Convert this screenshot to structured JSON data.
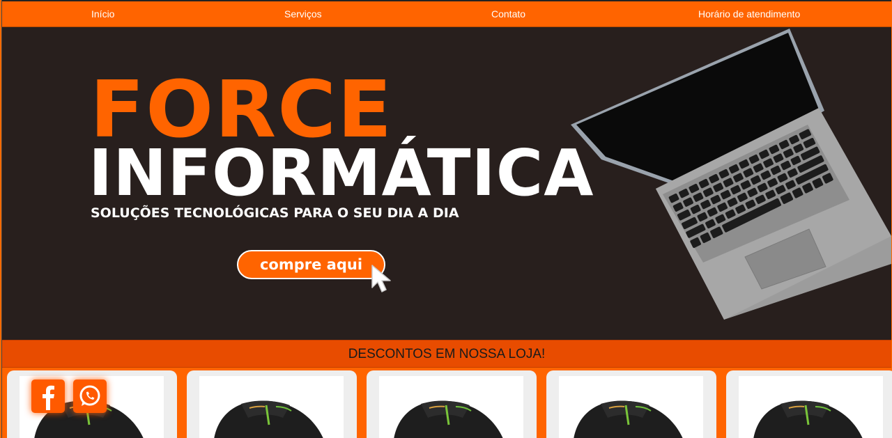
{
  "nav": {
    "items": [
      {
        "label": "Início"
      },
      {
        "label": "Serviços"
      },
      {
        "label": "Contato"
      },
      {
        "label": "Horário de atendimento"
      }
    ]
  },
  "hero": {
    "title_line1": "FORCE",
    "title_line2": "INFORMÁTICA",
    "subtitle": "SOLUÇÕES TECNOLÓGICAS PARA O SEU DIA A DIA",
    "cta_label": "compre aqui"
  },
  "banner": {
    "text": "DESCONTOS EM NOSSA LOJA!"
  },
  "products": {
    "count": 5,
    "image": "gaming-mouse-image"
  },
  "social": {
    "facebook": "facebook-icon",
    "whatsapp": "whatsapp-icon"
  },
  "colors": {
    "accent": "#ff6400",
    "banner": "#e84c00",
    "hero_bg": "#281f1d",
    "text_light": "#ffffff"
  }
}
